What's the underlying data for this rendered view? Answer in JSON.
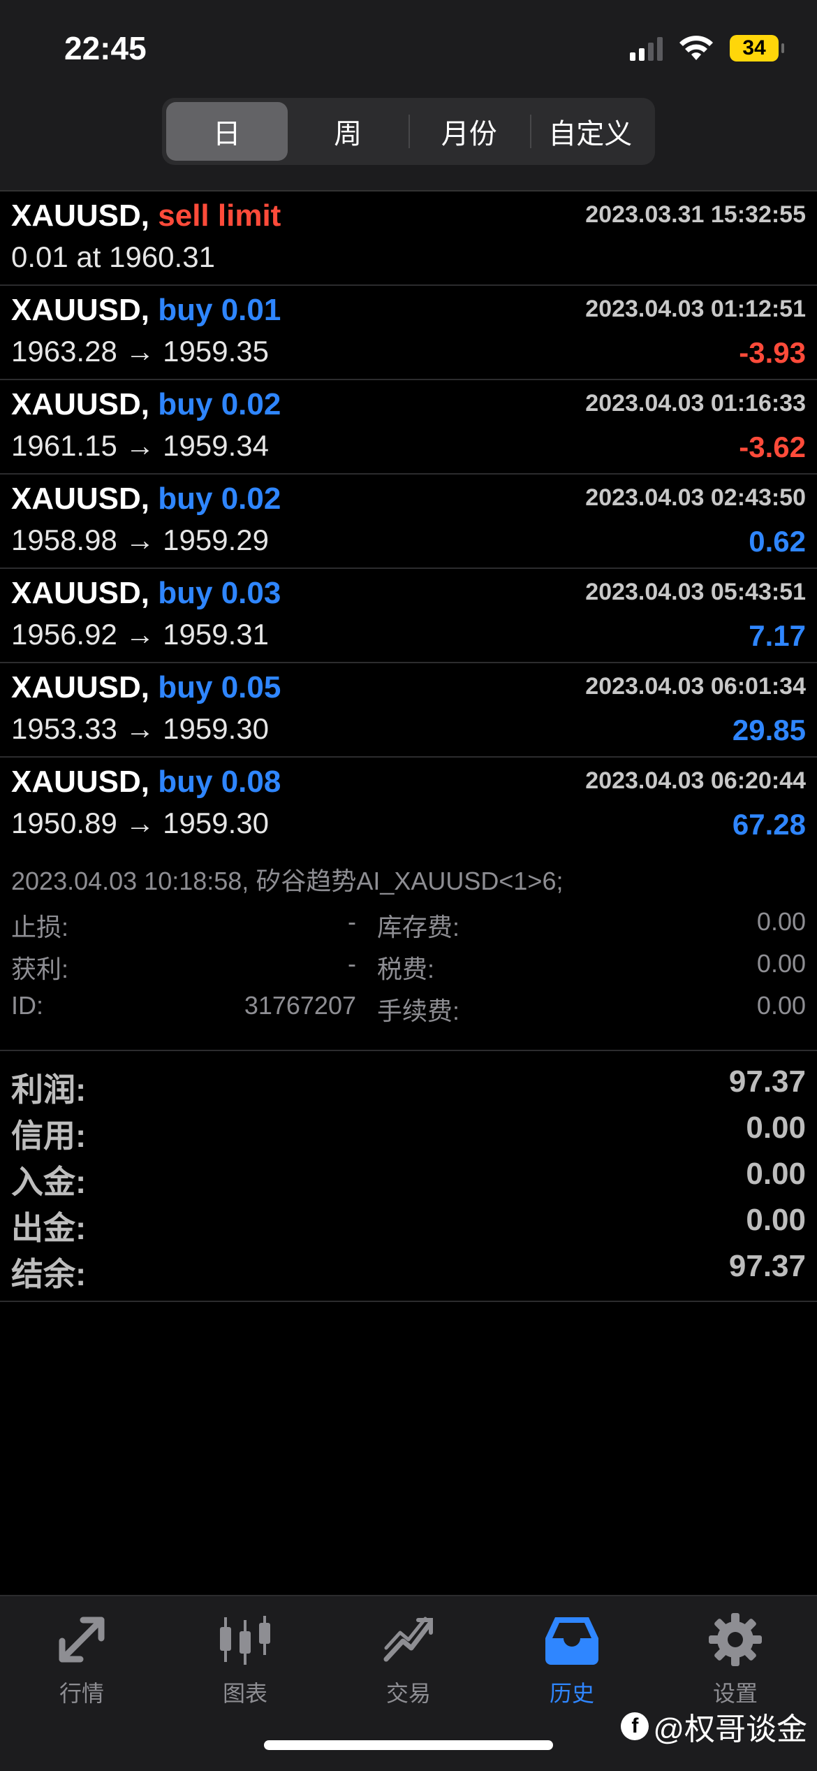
{
  "status_bar": {
    "time": "22:45",
    "battery": "34"
  },
  "segment": {
    "tabs": [
      "日",
      "周",
      "月份",
      "自定义"
    ],
    "active": 0
  },
  "trades": [
    {
      "symbol": "XAUUSD,",
      "action": "sell limit",
      "action_color": "#ff4b3a",
      "timestamp": "2023.03.31 15:32:55",
      "prices": "0.01 at 1960.31",
      "profit": "",
      "profit_color": "#ffffff"
    },
    {
      "symbol": "XAUUSD,",
      "action": "buy 0.01",
      "action_color": "#2f86ff",
      "timestamp": "2023.04.03 01:12:51",
      "prices": "1963.28 → 1959.35",
      "profit": "-3.93",
      "profit_color": "#ff4b3a"
    },
    {
      "symbol": "XAUUSD,",
      "action": "buy 0.02",
      "action_color": "#2f86ff",
      "timestamp": "2023.04.03 01:16:33",
      "prices": "1961.15 → 1959.34",
      "profit": "-3.62",
      "profit_color": "#ff4b3a"
    },
    {
      "symbol": "XAUUSD,",
      "action": "buy 0.02",
      "action_color": "#2f86ff",
      "timestamp": "2023.04.03 02:43:50",
      "prices": "1958.98 → 1959.29",
      "profit": "0.62",
      "profit_color": "#2f86ff"
    },
    {
      "symbol": "XAUUSD,",
      "action": "buy 0.03",
      "action_color": "#2f86ff",
      "timestamp": "2023.04.03 05:43:51",
      "prices": "1956.92 → 1959.31",
      "profit": "7.17",
      "profit_color": "#2f86ff"
    },
    {
      "symbol": "XAUUSD,",
      "action": "buy 0.05",
      "action_color": "#2f86ff",
      "timestamp": "2023.04.03 06:01:34",
      "prices": "1953.33 → 1959.30",
      "profit": "29.85",
      "profit_color": "#2f86ff"
    },
    {
      "symbol": "XAUUSD,",
      "action": "buy 0.08",
      "action_color": "#2f86ff",
      "timestamp": "2023.04.03 06:20:44",
      "prices": "1950.89 → 1959.30",
      "profit": "67.28",
      "profit_color": "#2f86ff"
    }
  ],
  "detail": {
    "comment": "2023.04.03 10:18:58, 矽谷趋势AI_XAUUSD<1>6;",
    "stop_loss_label": "止损:",
    "stop_loss_value": "-",
    "take_profit_label": "获利:",
    "take_profit_value": "-",
    "id_label": "ID:",
    "id_value": "31767207",
    "swap_label": "库存费:",
    "swap_value": "0.00",
    "tax_label": "税费:",
    "tax_value": "0.00",
    "commission_label": "手续费:",
    "commission_value": "0.00"
  },
  "summary": [
    {
      "label": "利润:",
      "value": "97.37"
    },
    {
      "label": "信用:",
      "value": "0.00"
    },
    {
      "label": "入金:",
      "value": "0.00"
    },
    {
      "label": "出金:",
      "value": "0.00"
    },
    {
      "label": "结余:",
      "value": "97.37"
    }
  ],
  "tabbar": [
    {
      "label": "行情",
      "icon": "quotes-arrows-icon"
    },
    {
      "label": "图表",
      "icon": "candlestick-chart-icon"
    },
    {
      "label": "交易",
      "icon": "trade-trend-icon"
    },
    {
      "label": "历史",
      "icon": "inbox-history-icon"
    },
    {
      "label": "设置",
      "icon": "gear-icon"
    }
  ],
  "tab_active": 3,
  "watermark": "@权哥谈金"
}
